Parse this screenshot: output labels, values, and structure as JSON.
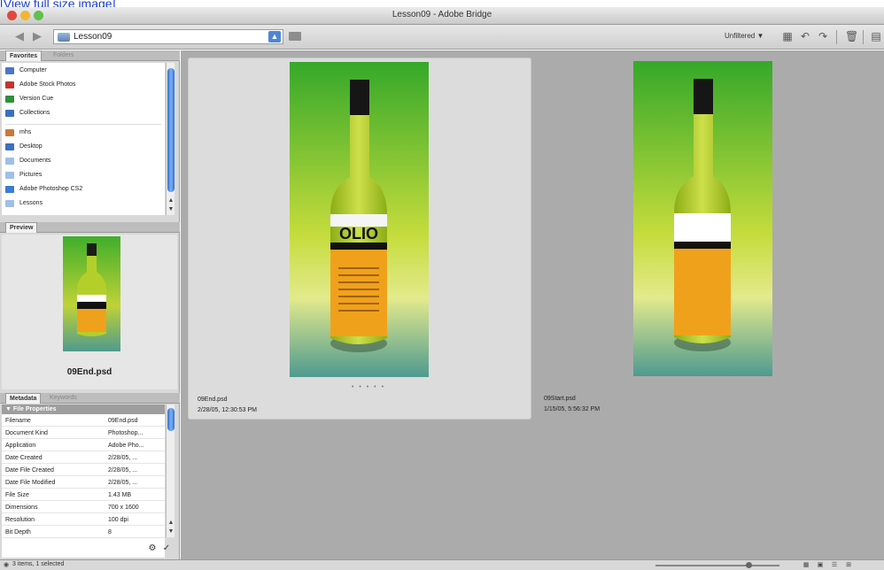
{
  "link_text": "[View full size image]",
  "window": {
    "title": "Lesson09 - Adobe Bridge"
  },
  "toolbar": {
    "back_glyph": "◀",
    "forward_glyph": "▶",
    "path_label": "Lesson09",
    "path_dropdown_glyph": "▲",
    "filter_label": "Unfiltered ▼",
    "icons": [
      "new-folder-icon",
      "rotate-left-icon",
      "rotate-right-icon",
      "trash-icon",
      "compact-mode-icon"
    ]
  },
  "favorites_panel": {
    "tabs": [
      "Favorites",
      "Folders"
    ],
    "items": [
      {
        "label": "Computer",
        "color": "#4a76c6"
      },
      {
        "label": "Adobe Stock Photos",
        "color": "#c2352d"
      },
      {
        "label": "Version Cue",
        "color": "#2f8f3a"
      },
      {
        "label": "Collections",
        "color": "#3b6fc1"
      },
      {
        "label": "mhs",
        "color": "#c87a3a"
      },
      {
        "label": "Desktop",
        "color": "#3b6fc1"
      },
      {
        "label": "Documents",
        "color": "#9ec0e8"
      },
      {
        "label": "Pictures",
        "color": "#9ec0e8"
      },
      {
        "label": "Adobe Photoshop CS2",
        "color": "#3a7bd5"
      },
      {
        "label": "Lessons",
        "color": "#9ec0e8"
      }
    ]
  },
  "preview_panel": {
    "tab": "Preview",
    "filename": "09End.psd"
  },
  "metadata_panel": {
    "tabs": [
      "Metadata",
      "Keywords"
    ],
    "section": "▼ File Properties",
    "rows": [
      {
        "key": "Filename",
        "value": "09End.psd"
      },
      {
        "key": "Document Kind",
        "value": "Photoshop..."
      },
      {
        "key": "Application",
        "value": "Adobe Pho..."
      },
      {
        "key": "Date Created",
        "value": "2/28/05, ..."
      },
      {
        "key": "Date File Created",
        "value": "2/28/05, ..."
      },
      {
        "key": "Date File Modified",
        "value": "2/28/05, ..."
      },
      {
        "key": "File Size",
        "value": "1.43 MB"
      },
      {
        "key": "Dimensions",
        "value": "700 x 1600"
      },
      {
        "key": "Resolution",
        "value": "100 dpi"
      },
      {
        "key": "Bit Depth",
        "value": "8"
      }
    ]
  },
  "content": {
    "items": [
      {
        "name": "09End.psd",
        "date": "2/28/05, 12:30:53 PM",
        "selected": true,
        "label_text": "OLIO",
        "dots": "• • • • •"
      },
      {
        "name": "09Start.psd",
        "date": "1/15/05, 5:56:32 PM",
        "selected": false
      }
    ]
  },
  "statusbar": {
    "text": "3 items, 1 selected",
    "view_buttons": [
      "filmstrip-view-icon",
      "thumbnail-view-icon",
      "details-view-icon",
      "versions-view-icon"
    ],
    "thumbnail_size": 0.75
  }
}
